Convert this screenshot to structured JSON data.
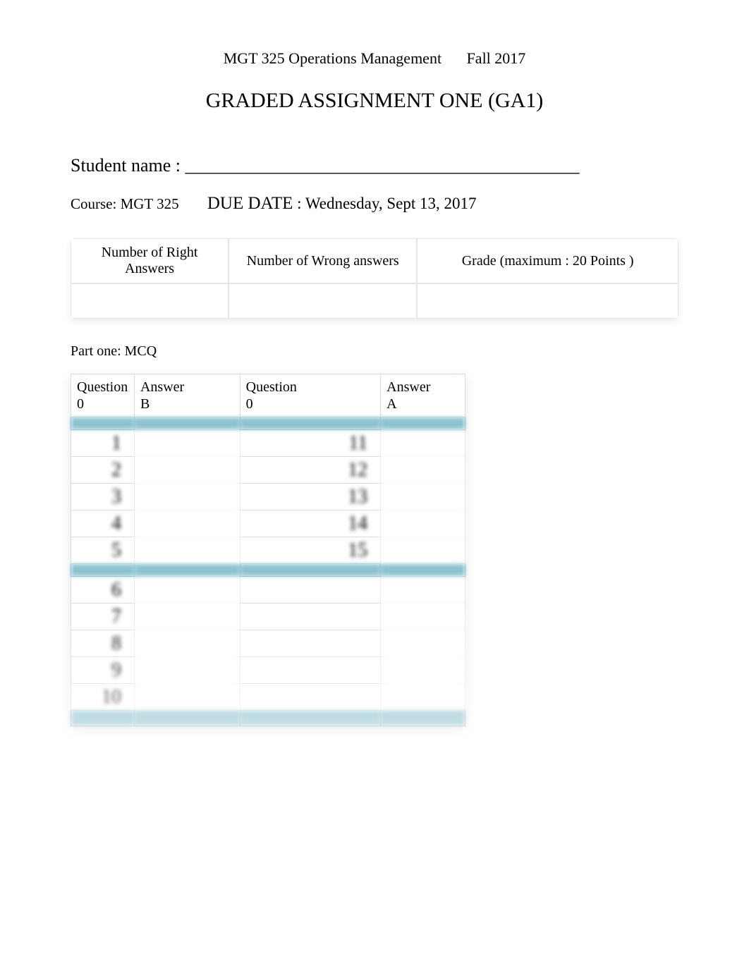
{
  "header": {
    "course_title": "MGT 325 Operations Management",
    "term": "Fall 2017"
  },
  "title": "GRADED ASSIGNMENT ONE (GA1)",
  "student": {
    "label": "Student name  :",
    "blank_line": "___________________________________________"
  },
  "info": {
    "course_label": "Course: MGT 325",
    "due_date_label": "DUE DATE",
    "due_date_sep": " : ",
    "due_date_value": "Wednesday, Sept 13, 2017"
  },
  "grade_table": {
    "headers": {
      "right": "Number of Right Answers",
      "wrong": "Number of Wrong answers",
      "grade": "Grade (maximum : 20 Points )"
    },
    "values": {
      "right": "",
      "wrong": "",
      "grade": ""
    }
  },
  "part_label": "Part one: MCQ",
  "answer_headers": {
    "q1_label": "Question",
    "q1_zero": "0",
    "a1_label": "Answer",
    "a1_ex": "B",
    "q2_label": "Question",
    "q2_zero": "0",
    "a2_label": "Answer",
    "a2_ex": "A"
  },
  "rows_left": [
    {
      "q": "1"
    },
    {
      "q": "2"
    },
    {
      "q": "3"
    },
    {
      "q": "4"
    },
    {
      "q": "5"
    },
    {
      "q": "6"
    },
    {
      "q": "7"
    },
    {
      "q": "8"
    },
    {
      "q": "9"
    },
    {
      "q": "10"
    }
  ],
  "rows_right": [
    {
      "q": "11"
    },
    {
      "q": "12"
    },
    {
      "q": "13"
    },
    {
      "q": "14"
    },
    {
      "q": "15"
    },
    {
      "q": ""
    },
    {
      "q": ""
    },
    {
      "q": ""
    },
    {
      "q": ""
    },
    {
      "q": ""
    }
  ]
}
